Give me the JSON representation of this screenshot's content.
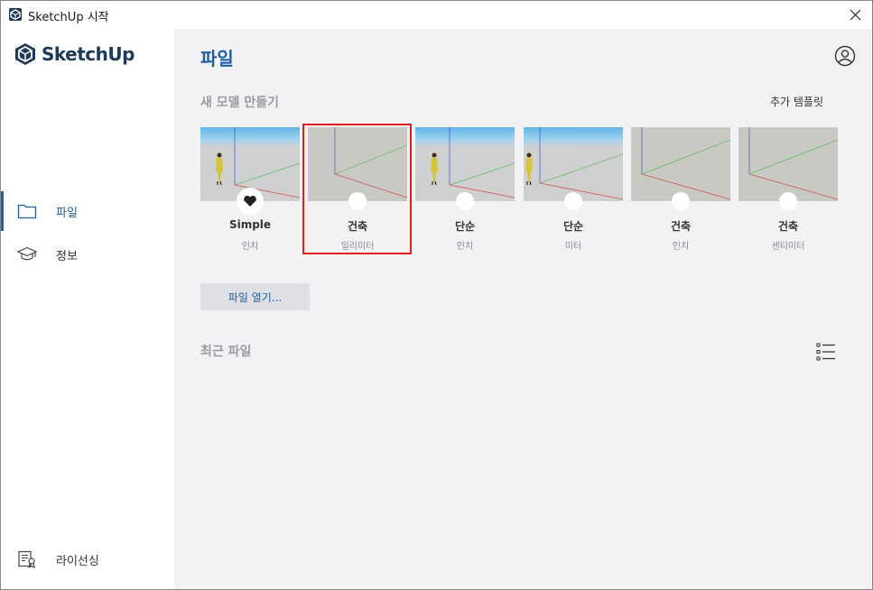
{
  "window": {
    "title": "SketchUp 시작"
  },
  "sidebar": {
    "logo_text": "SketchUp",
    "items": [
      {
        "label": "파일",
        "icon": "folder-icon"
      },
      {
        "label": "정보",
        "icon": "graduation-cap-icon"
      }
    ],
    "license_label": "라이선싱"
  },
  "main": {
    "title": "파일",
    "new_model_title": "새 모델 만들기",
    "more_templates": "추가 템플릿",
    "templates": [
      {
        "name": "Simple",
        "unit": "인치"
      },
      {
        "name": "건축",
        "unit": "밀리미터"
      },
      {
        "name": "단순",
        "unit": "인치"
      },
      {
        "name": "단순",
        "unit": "미터"
      },
      {
        "name": "건축",
        "unit": "인치"
      },
      {
        "name": "건축",
        "unit": "센티미터"
      }
    ],
    "open_file_label": "파일 열기...",
    "recent_files_title": "최근 파일"
  },
  "colors": {
    "accent": "#1b5fa3",
    "selection": "#e01e1e",
    "sky": "#5fb4e6"
  }
}
